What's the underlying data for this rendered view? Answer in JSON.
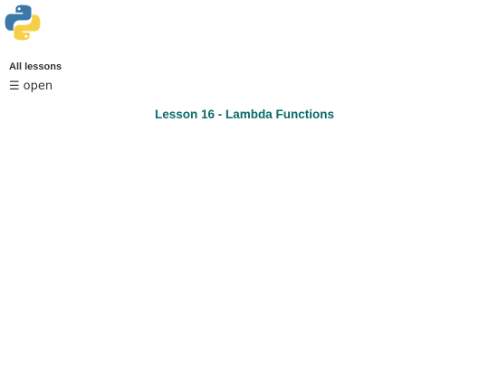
{
  "header": {
    "logo_icon": "python-logo-icon"
  },
  "nav": {
    "all_lessons_label": "All lessons",
    "menu_toggle_glyph": "☰",
    "menu_toggle_label": "open"
  },
  "main": {
    "lesson_title": "Lesson 16 - Lambda Functions"
  },
  "colors": {
    "title": "#0b6b6b",
    "python_blue": "#3b77a8",
    "python_yellow": "#f7cf47"
  }
}
